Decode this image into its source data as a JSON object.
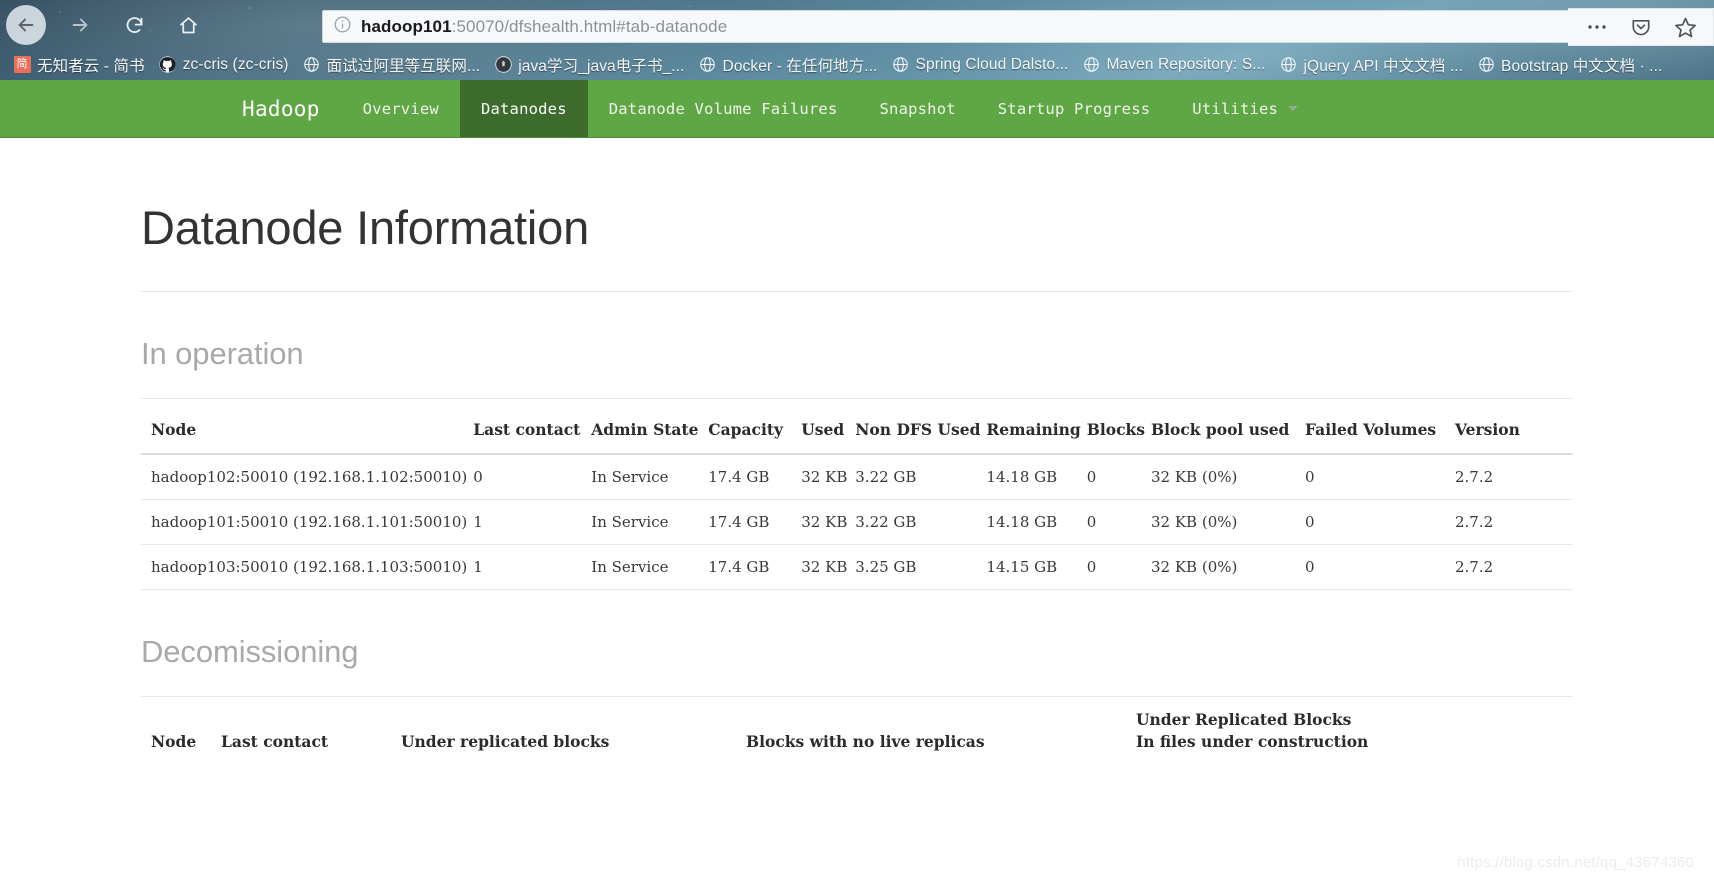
{
  "browser": {
    "url_host": "hadoop101",
    "url_rest": ":50070/dfshealth.html#tab-datanode",
    "url_full": "hadoop101:50070/dfshealth.html#tab-datanode",
    "back_icon": "back-arrow-icon",
    "forward_icon": "forward-arrow-icon",
    "reload_icon": "reload-icon",
    "home_icon": "home-icon",
    "identity_icon": "info-circle-icon",
    "menu_icon": "ellipsis-icon",
    "pocket_icon": "pocket-icon",
    "bookmark_icon": "star-icon",
    "bookmarks": [
      {
        "label": "无知者云 - 简书",
        "icon": "jianshu-icon"
      },
      {
        "label": "zc-cris (zc-cris)",
        "icon": "github-icon"
      },
      {
        "label": "面试过阿里等互联网...",
        "icon": "globe-icon"
      },
      {
        "label": "java学习_java电子书_...",
        "icon": "dark-circle-icon"
      },
      {
        "label": "Docker - 在任何地方...",
        "icon": "globe-icon"
      },
      {
        "label": "Spring Cloud Dalsto...",
        "icon": "globe-icon"
      },
      {
        "label": "Maven Repository: S...",
        "icon": "globe-icon"
      },
      {
        "label": "jQuery API 中文文档 ...",
        "icon": "globe-icon"
      },
      {
        "label": "Bootstrap 中文文档 · ...",
        "icon": "globe-icon"
      }
    ]
  },
  "hadoop_nav": {
    "brand": "Hadoop",
    "items": [
      {
        "label": "Overview",
        "active": false
      },
      {
        "label": "Datanodes",
        "active": true
      },
      {
        "label": "Datanode Volume Failures",
        "active": false
      },
      {
        "label": "Snapshot",
        "active": false
      },
      {
        "label": "Startup Progress",
        "active": false
      },
      {
        "label": "Utilities",
        "active": false,
        "dropdown": true
      }
    ],
    "accent_color": "#5fa644",
    "active_color": "#3d6b2c"
  },
  "main": {
    "title": "Datanode Information",
    "in_operation": {
      "heading": "In operation",
      "columns": [
        "Node",
        "Last contact",
        "Admin State",
        "Capacity",
        "Used",
        "Non DFS Used",
        "Remaining",
        "Blocks",
        "Block pool used",
        "Failed Volumes",
        "Version"
      ],
      "rows": [
        {
          "node": "hadoop102:50010 (192.168.1.102:50010)",
          "last_contact": "0",
          "admin_state": "In Service",
          "capacity": "17.4 GB",
          "used": "32 KB",
          "non_dfs_used": "3.22 GB",
          "remaining": "14.18 GB",
          "blocks": "0",
          "block_pool_used": "32 KB (0%)",
          "failed_volumes": "0",
          "version": "2.7.2"
        },
        {
          "node": "hadoop101:50010 (192.168.1.101:50010)",
          "last_contact": "1",
          "admin_state": "In Service",
          "capacity": "17.4 GB",
          "used": "32 KB",
          "non_dfs_used": "3.22 GB",
          "remaining": "14.18 GB",
          "blocks": "0",
          "block_pool_used": "32 KB (0%)",
          "failed_volumes": "0",
          "version": "2.7.2"
        },
        {
          "node": "hadoop103:50010 (192.168.1.103:50010)",
          "last_contact": "1",
          "admin_state": "In Service",
          "capacity": "17.4 GB",
          "used": "32 KB",
          "non_dfs_used": "3.25 GB",
          "remaining": "14.15 GB",
          "blocks": "0",
          "block_pool_used": "32 KB (0%)",
          "failed_volumes": "0",
          "version": "2.7.2"
        }
      ]
    },
    "decomissioning": {
      "heading": "Decomissioning",
      "columns": [
        "Node",
        "Last contact",
        "Under replicated blocks",
        "Blocks with no live replicas",
        "Under Replicated Blocks\nIn files under construction"
      ],
      "col_urbc_line1": "Under Replicated Blocks",
      "col_urbc_line2": "In files under construction",
      "rows": []
    }
  },
  "watermark": "https://blog.csdn.net/qq_43674360"
}
